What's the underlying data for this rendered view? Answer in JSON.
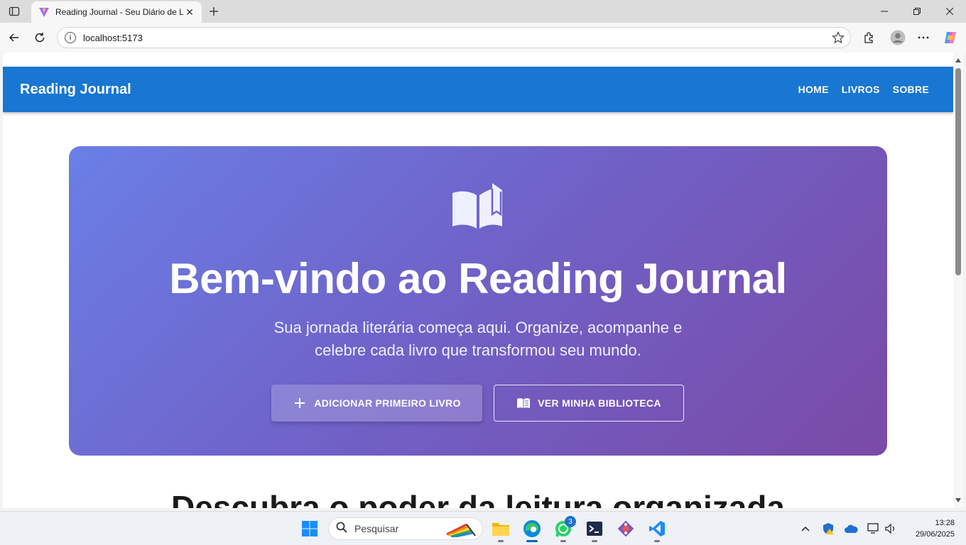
{
  "browser": {
    "tab_title": "Reading Journal - Seu Diário de L",
    "tab_close": "✕",
    "new_tab": "+",
    "address_url": "localhost:5173",
    "address_info": "i"
  },
  "app": {
    "brand": "Reading Journal",
    "nav": [
      {
        "label": "HOME"
      },
      {
        "label": "LIVROS"
      },
      {
        "label": "SOBRE"
      }
    ],
    "colors": {
      "appbar": "#1976d2",
      "hero_start": "#6a7fe6",
      "hero_end": "#7a4aa6"
    }
  },
  "hero": {
    "icon": "open-book-icon",
    "title": "Bem-vindo ao Reading Journal",
    "subtitle": "Sua jornada literária começa aqui. Organize, acompanhe e celebre cada livro que transformou seu mundo.",
    "primary_button": {
      "icon": "plus-icon",
      "label": "ADICIONAR PRIMEIRO LIVRO"
    },
    "secondary_button": {
      "icon": "menu-book-icon",
      "label": "VER MINHA BIBLIOTECA"
    }
  },
  "section": {
    "title": "Descubra o poder da leitura organizada"
  },
  "taskbar": {
    "search_placeholder": "Pesquisar",
    "whatsapp_badge": "3",
    "time": "13:28",
    "date": "29/06/2025",
    "apps": [
      "file-explorer-icon",
      "edge-icon",
      "whatsapp-icon",
      "terminal-icon",
      "git-icon",
      "vscode-icon"
    ]
  }
}
